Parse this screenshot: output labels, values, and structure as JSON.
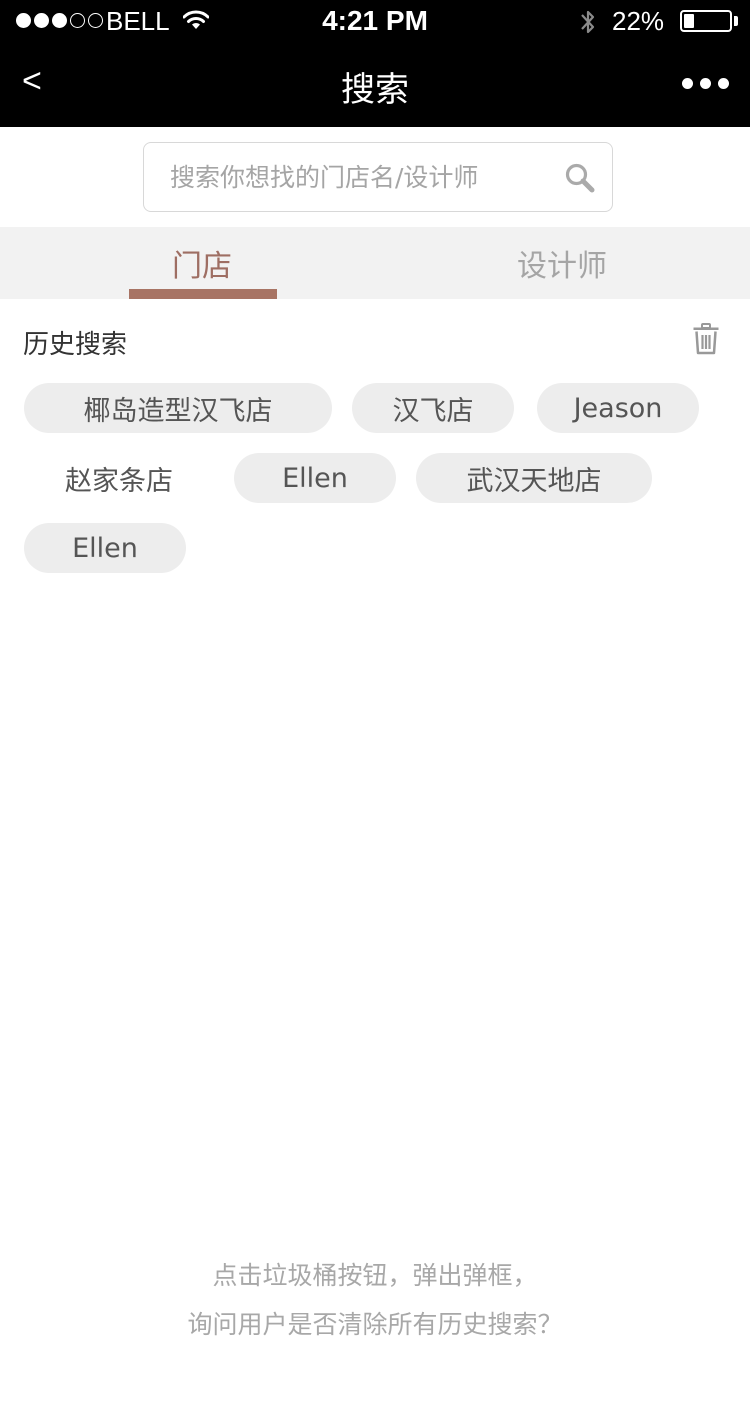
{
  "status_bar": {
    "carrier": "BELL",
    "time": "4:21 PM",
    "battery_percent": "22%",
    "battery_level": 0.22
  },
  "nav": {
    "back_label": "<",
    "title": "搜索"
  },
  "search": {
    "placeholder": "搜索你想找的门店名/设计师",
    "value": ""
  },
  "tabs": [
    {
      "label": "门店",
      "active": true
    },
    {
      "label": "设计师",
      "active": false
    }
  ],
  "history": {
    "title": "历史搜索",
    "items": [
      "椰岛造型汉飞店",
      "汉飞店",
      "Jeason",
      "赵家条店",
      "Ellen",
      "武汉天地店",
      "Ellen"
    ]
  },
  "hint": {
    "line1": "点击垃圾桶按钮，弹出弹框，",
    "line2": "询问用户是否清除所有历史搜索？"
  },
  "colors": {
    "accent": "#a87464",
    "chip_bg": "#ededed",
    "bar_bg": "#000000"
  }
}
